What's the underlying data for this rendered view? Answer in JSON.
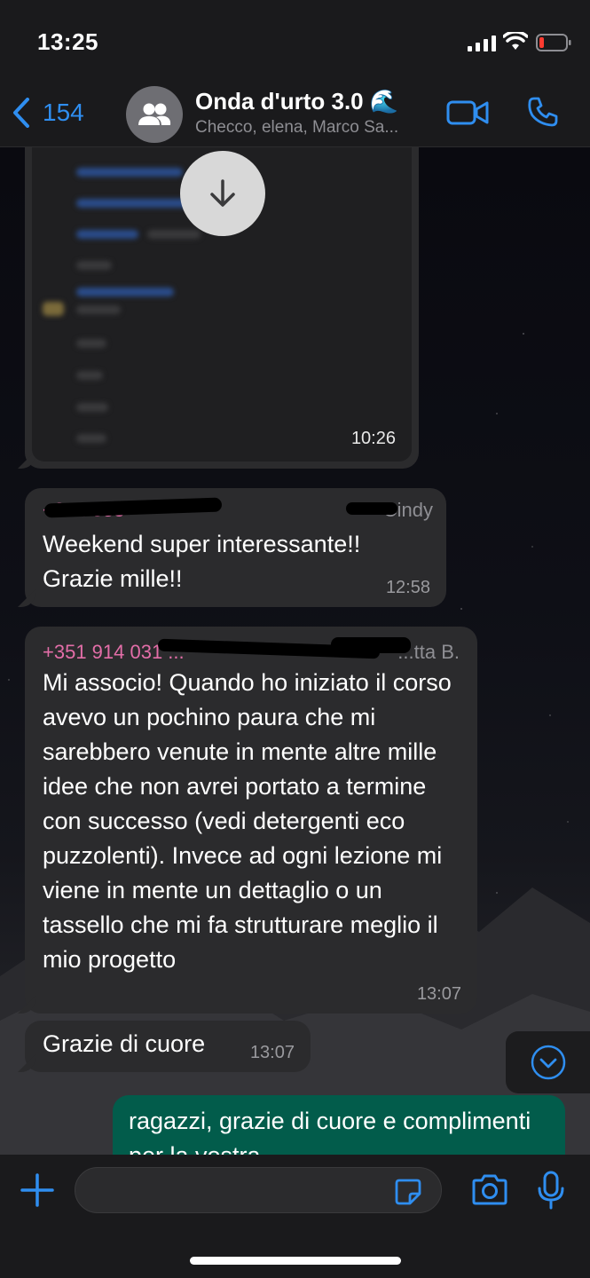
{
  "status_bar": {
    "time": "13:25"
  },
  "header": {
    "back_count": "154",
    "group_name": "Onda d'urto 3.0 🌊",
    "members": "Checco, elena, Marco Sa..."
  },
  "messages": [
    {
      "type": "image",
      "time": "10:26"
    },
    {
      "sender": "+3 ... 553",
      "sender_name": "Cindy",
      "text": "Weekend super interessante!! Grazie mille!!",
      "time": "12:58"
    },
    {
      "sender": "+351 914 031 ...",
      "sender_name": "~ ...tta B.",
      "text": "Mi associo! Quando ho iniziato il corso avevo un pochino paura che mi sarebbero venute in mente altre mille idee che non avrei portato a termine con successo (vedi detergenti eco puzzolenti). Invece ad ogni lezione mi viene in mente un dettaglio o un tassello che mi fa strutturare meglio il mio progetto",
      "time": "13:07"
    },
    {
      "text": "Grazie di cuore",
      "time": "13:07"
    },
    {
      "text": "ragazzi, grazie di cuore e complimenti per la vostra",
      "outgoing": true
    }
  ],
  "input": {
    "placeholder": ""
  },
  "colors": {
    "accent": "#2f8ef0",
    "outgoing_bubble": "#025c4b",
    "incoming_bubble": "#2b2b2d",
    "sender": "#e36ea8"
  }
}
